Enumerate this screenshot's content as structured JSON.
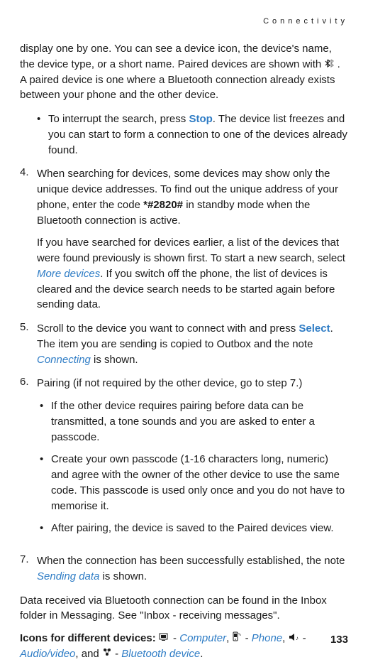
{
  "header": {
    "title": "Connectivity"
  },
  "intro": {
    "p1_a": "display one by one. You can see a device icon, the device's name, the device type, or a short name. Paired devices are shown with ",
    "p1_b": ". A paired device is one where a Bluetooth connection already exists between your phone and the other device."
  },
  "bullet1": {
    "text_a": "To interrupt the search, press ",
    "stop": "Stop",
    "text_b": ". The device list freezes and you can start to form a connection to one of the devices already found."
  },
  "step4": {
    "num": "4.",
    "p1_a": "When searching for devices, some devices may show only the unique device addresses. To find out the unique address of your phone, enter the code ",
    "code": "*#2820#",
    "p1_b": " in standby mode when the Bluetooth connection is active.",
    "p2_a": "If you have searched for devices earlier, a list of the devices that were found previously is shown first. To start a new search, select ",
    "more_devices": "More devices",
    "p2_b": ". If you switch off the phone, the list of devices is cleared and the device search needs to be started again before sending data."
  },
  "step5": {
    "num": "5.",
    "text_a": "Scroll to the device you want to connect with and press ",
    "select": "Select",
    "text_b": ". The item you are sending is copied to Outbox and the note ",
    "connecting": "Connecting",
    "text_c": " is shown."
  },
  "step6": {
    "num": "6.",
    "text": "Pairing (if not required by the other device, go to step 7.)",
    "b1": "If the other device requires pairing before data can be transmitted, a tone sounds and you are asked to enter a passcode.",
    "b2": "Create your own passcode (1-16 characters long, numeric) and agree with the owner of the other device to use the same code. This passcode is used only once and you do not have to memorise it.",
    "b3": "After pairing, the device is saved to the Paired devices view."
  },
  "step7": {
    "num": "7.",
    "text_a": "When the connection has been successfully established, the note ",
    "sending_data": "Sending data",
    "text_b": " is shown."
  },
  "footer": {
    "p1": "Data received via Bluetooth connection can be found in the Inbox folder in Messaging. See \"Inbox - receiving messages\".",
    "icons_label": "Icons for different devices:",
    "dash1": " - ",
    "computer": "Computer",
    "comma1": ", ",
    "dash2": " - ",
    "phone": "Phone",
    "comma2": ", ",
    "dash3": " - ",
    "audiovideo": "Audio/video",
    "and": ", and ",
    "dash4": " - ",
    "btdevice": "Bluetooth device",
    "period": "."
  },
  "page_number": "133"
}
